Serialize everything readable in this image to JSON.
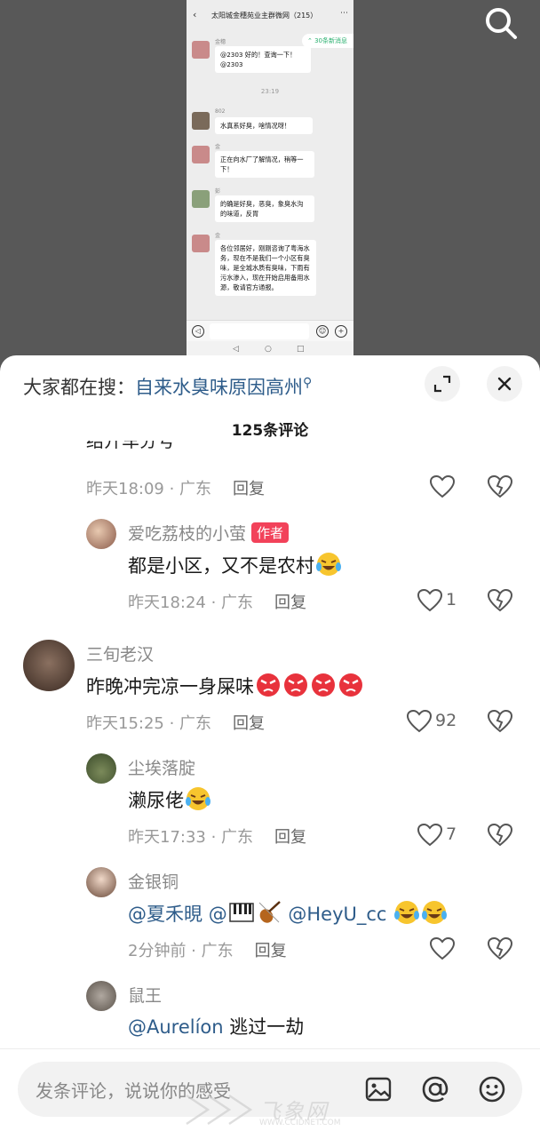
{
  "chat_screenshot": {
    "title": "太阳城金穗苑业主群微网（215）",
    "new_messages_pill": "30条新消息",
    "time_divider": "23:19",
    "messages": [
      {
        "name": "金穗",
        "text": "@2303 好的！查询一下！\n@2303"
      },
      {
        "name": "802",
        "text": "水真系好臭，啥情况呀！"
      },
      {
        "name": "金",
        "text": "正在向水厂了解情况，稍等一下！"
      },
      {
        "name": "彭",
        "text": "的确是好臭，恶臭，象臭水沟的味道，反胃"
      },
      {
        "name": "金",
        "text": "各位邻居好，刚刚咨询了粤海水务，现在不是我们一个小区有臭味，是全城水质有臭味，下雨有污水渗入，现在开始启用备用水源，敬请官方通报。"
      }
    ]
  },
  "panel": {
    "search_label": "大家都在搜：",
    "search_query": "自来水臭味原因高州",
    "comment_count": "125条评论",
    "partial_text": "结开车分号",
    "reply_label": "回复"
  },
  "comments": [
    {
      "id": "c0",
      "name": "",
      "text": "",
      "time": "昨天18:09",
      "location": "广东",
      "likes": ""
    },
    {
      "id": "c1",
      "name": "爱吃荔枝的小萤",
      "badge": "作者",
      "text": "都是小区，又不是农村",
      "time": "昨天18:24",
      "location": "广东",
      "likes": "1"
    },
    {
      "id": "c2",
      "name": "三旬老汉",
      "text": "昨晚冲完凉一身屎味",
      "time": "昨天15:25",
      "location": "广东",
      "likes": "92"
    },
    {
      "id": "c3",
      "name": "尘埃落腚",
      "text": "濑尿佬",
      "time": "昨天17:33",
      "location": "广东",
      "likes": "7"
    },
    {
      "id": "c4",
      "name": "金银铜",
      "mention1": "@夏禾晛",
      "mention2": "@",
      "mention3": "@HeyU_cc",
      "time": "2分钟前",
      "location": "广东",
      "likes": ""
    },
    {
      "id": "c5",
      "name": "鼠王",
      "mention1": "@Aurelíon",
      "text": " 逃过一劫"
    }
  ],
  "input": {
    "placeholder": "发条评论，说说你的感受"
  },
  "watermark": {
    "text": "飞象网",
    "url": "WWW.CCIDNET.COM"
  },
  "colors": {
    "mention": "#2e5c8a",
    "badge": "#f2425a",
    "panel_bg": "#ffffff",
    "video_bg": "#585858"
  }
}
